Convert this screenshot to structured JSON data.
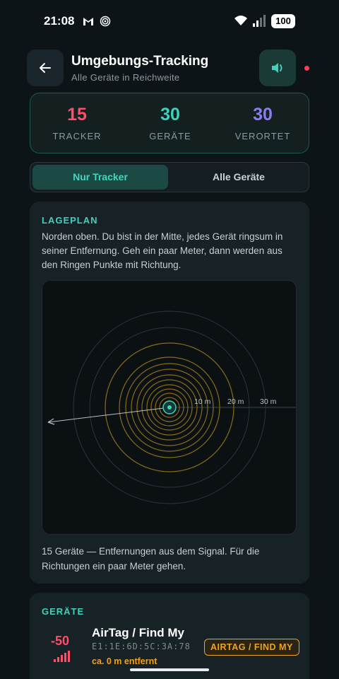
{
  "status_bar": {
    "time": "21:08",
    "battery": "100"
  },
  "header": {
    "title": "Umgebungs-Tracking",
    "subtitle": "Alle Geräte in Reichweite"
  },
  "stats": [
    {
      "value": "15",
      "label": "TRACKER",
      "color": "#ff4d6a"
    },
    {
      "value": "30",
      "label": "GERÄTE",
      "color": "#3fd1bb"
    },
    {
      "value": "30",
      "label": "VERORTET",
      "color": "#8b7cf6"
    }
  ],
  "filter": {
    "active": "Nur Tracker",
    "inactive": "Alle Geräte"
  },
  "map": {
    "title": "LAGEPLAN",
    "description": "Norden oben. Du bist in der Mitte, jedes Gerät ringsum in seiner Entfernung. Geh ein paar Meter, dann werden aus den Ringen Punkte mit Richtung.",
    "ring_labels": [
      "10 m",
      "20 m",
      "30 m"
    ],
    "footer": "15 Geräte — Entfernungen aus dem Signal. Für die Richtungen ein paar Meter gehen."
  },
  "devices": {
    "title": "GERÄTE",
    "items": [
      {
        "rssi": "-50",
        "name": "AirTag / Find My",
        "mac": "E1:1E:6D:5C:3A:78",
        "distance": "ca. 0 m entfernt",
        "badge": "AIRTAG / FIND MY"
      }
    ]
  },
  "colors": {
    "accent": "#3fd1bb",
    "tracker_ring": "#e3a21c",
    "alert": "#ff4d6a"
  }
}
